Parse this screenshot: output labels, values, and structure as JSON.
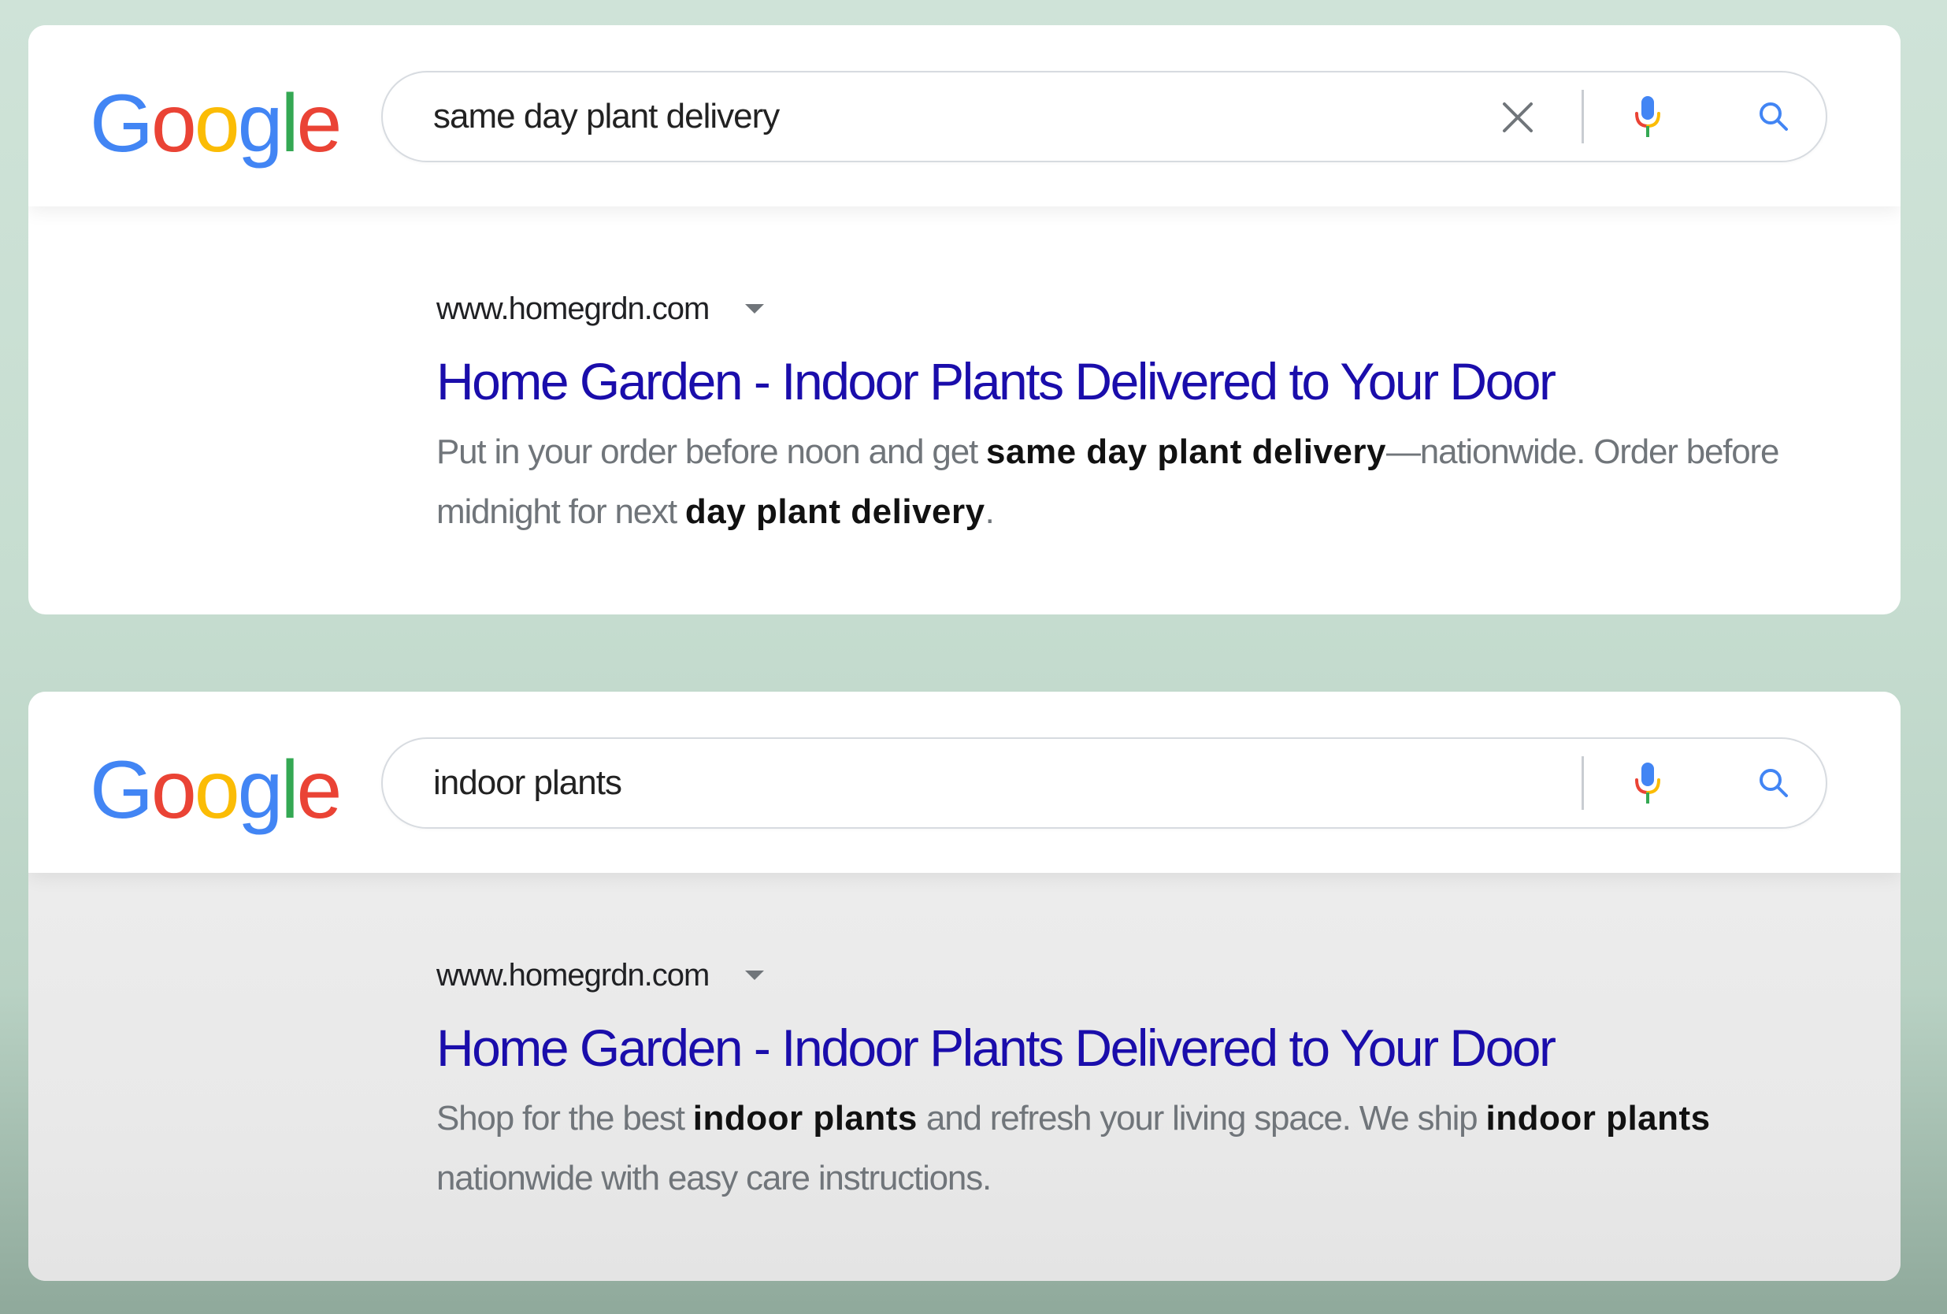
{
  "colors": {
    "blue": "#4285F4",
    "red": "#EA4335",
    "yellow": "#FBBC05",
    "green": "#34A853",
    "link": "#1a0dab"
  },
  "cards": [
    {
      "logo": {
        "letters": [
          "G",
          "o",
          "o",
          "g",
          "l",
          "e"
        ]
      },
      "search": {
        "query": "same day plant delivery"
      },
      "result": {
        "url": "www.homegrdn.com",
        "title": "Home Garden - Indoor Plants Delivered to Your Door",
        "snippet": {
          "p1": "Put in your order before noon and get ",
          "b1": "same day plant delivery",
          "p2": "—nationwide. Order before midnight for next ",
          "b2": "day plant delivery",
          "p3": "."
        }
      }
    },
    {
      "logo": {
        "letters": [
          "G",
          "o",
          "o",
          "g",
          "l",
          "e"
        ]
      },
      "search": {
        "query": "indoor plants"
      },
      "result": {
        "url": "www.homegrdn.com",
        "title": "Home Garden - Indoor Plants Delivered to Your Door",
        "snippet": {
          "p1": "Shop for the best ",
          "b1": "indoor plants",
          "p2": " and refresh your living space. We ship ",
          "b2": "indoor plants",
          "p3": " nationwide with easy care instructions."
        }
      }
    }
  ]
}
